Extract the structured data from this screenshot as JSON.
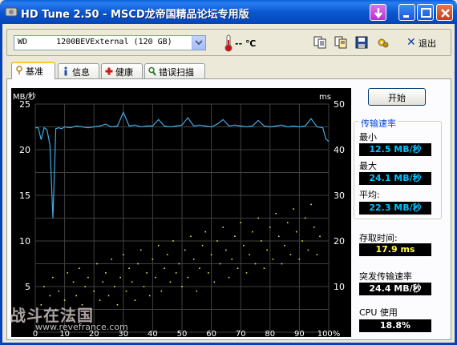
{
  "window": {
    "title": "HD Tune 2.50 - MSCD龙帝国精品论坛专用版"
  },
  "toolbar": {
    "drive": "WD      1200BEVExternal (120 GB)",
    "temperature": "-- ℃",
    "exit_label": "退出"
  },
  "tabs": [
    {
      "label": "基准",
      "icon": "benchmark-icon",
      "active": true
    },
    {
      "label": "信息",
      "icon": "info-icon",
      "active": false
    },
    {
      "label": "健康",
      "icon": "health-icon",
      "active": false
    },
    {
      "label": "错误扫描",
      "icon": "scan-icon",
      "active": false
    }
  ],
  "right_panel": {
    "start_label": "开始",
    "transfer_title": "传输速率",
    "min_label": "最小",
    "min_value": "12.5 MB/秒",
    "max_label": "最大",
    "max_value": "24.1 MB/秒",
    "avg_label": "平均:",
    "avg_value": "22.3 MB/秒",
    "access_label": "存取时间:",
    "access_value": "17.9 ms",
    "burst_label": "突发传输速率",
    "burst_value": "24.4 MB/秒",
    "cpu_label": "CPU 使用",
    "cpu_value": "18.8%"
  },
  "watermark": {
    "line1": "战斗在法国",
    "line2": "www.revefrance.com"
  },
  "chart_data": {
    "type": "line",
    "left_axis_unit": "MB/秒",
    "right_axis_unit": "ms",
    "ylim_left": [
      0,
      25
    ],
    "ylim_right": [
      0,
      50
    ],
    "xlim": [
      0,
      100
    ],
    "y_ticks_left": [
      "5",
      "10",
      "15",
      "20",
      "25"
    ],
    "y_ticks_right": [
      "10",
      "20",
      "30",
      "40",
      "50"
    ],
    "x_ticks": [
      "0",
      "10",
      "20",
      "30",
      "40",
      "50",
      "60",
      "70",
      "80",
      "90",
      "100%"
    ],
    "grid": true,
    "colors": {
      "background": "#000000",
      "grid": "#404040",
      "transfer": "#3fa9e6",
      "access": "#e6e640"
    },
    "series": [
      {
        "kind": "transfer_rate",
        "x": [
          0,
          1,
          2,
          3,
          4,
          5,
          6,
          7,
          8,
          9,
          10,
          12,
          14,
          16,
          18,
          20,
          22,
          24,
          26,
          28,
          30,
          32,
          34,
          36,
          38,
          40,
          42,
          44,
          46,
          48,
          50,
          52,
          54,
          56,
          58,
          60,
          62,
          64,
          66,
          68,
          70,
          72,
          74,
          76,
          78,
          80,
          82,
          84,
          86,
          88,
          90,
          92,
          94,
          96,
          98,
          99,
          100
        ],
        "y": [
          22.4,
          22.4,
          21.1,
          22.4,
          22.2,
          20.5,
          12.5,
          22.3,
          22.4,
          22.3,
          22.5,
          22.4,
          22.6,
          22.5,
          22.4,
          22.5,
          22.6,
          22.8,
          22.5,
          22.6,
          24.1,
          22.6,
          22.7,
          22.5,
          22.6,
          22.6,
          23.3,
          22.6,
          22.5,
          22.6,
          22.7,
          23.5,
          22.6,
          22.7,
          22.6,
          22.5,
          22.8,
          23.3,
          22.6,
          22.7,
          22.6,
          22.5,
          22.6,
          23.2,
          22.6,
          22.5,
          22.6,
          22.7,
          22.5,
          22.6,
          22.5,
          22.6,
          23.4,
          22.5,
          22.4,
          21.2,
          20.9
        ]
      },
      {
        "kind": "access_time",
        "x": [
          2,
          3,
          4,
          5,
          6,
          7,
          8,
          10,
          11,
          12,
          13,
          14,
          15,
          16,
          17,
          18,
          19,
          20,
          21,
          22,
          23,
          24,
          25,
          26,
          27,
          28,
          29,
          30,
          31,
          32,
          33,
          34,
          35,
          36,
          37,
          38,
          39,
          40,
          41,
          42,
          43,
          44,
          45,
          46,
          47,
          48,
          49,
          50,
          51,
          52,
          53,
          54,
          55,
          56,
          57,
          58,
          59,
          60,
          61,
          62,
          63,
          64,
          65,
          66,
          67,
          68,
          69,
          70,
          71,
          72,
          73,
          74,
          75,
          76,
          77,
          78,
          79,
          80,
          81,
          82,
          83,
          84,
          85,
          86,
          87,
          88,
          89,
          90,
          91,
          92,
          93,
          94,
          95,
          96,
          97
        ],
        "y": [
          6,
          10,
          4,
          8,
          12,
          5,
          9,
          7,
          13,
          3,
          11,
          8,
          14,
          6,
          10,
          12,
          5,
          9,
          15,
          7,
          11,
          13,
          8,
          16,
          10,
          6,
          12,
          17,
          9,
          14,
          11,
          7,
          15,
          18,
          10,
          13,
          8,
          16,
          12,
          19,
          9,
          14,
          17,
          11,
          20,
          13,
          15,
          10,
          18,
          12,
          21,
          16,
          9,
          14,
          19,
          22,
          13,
          17,
          11,
          20,
          15,
          23,
          18,
          12,
          16,
          21,
          14,
          24,
          19,
          13,
          17,
          22,
          15,
          25,
          20,
          14,
          18,
          23,
          16,
          26,
          21,
          15,
          19,
          24,
          17,
          27,
          22,
          16,
          20,
          25,
          18,
          28,
          23,
          17,
          21
        ]
      }
    ]
  }
}
